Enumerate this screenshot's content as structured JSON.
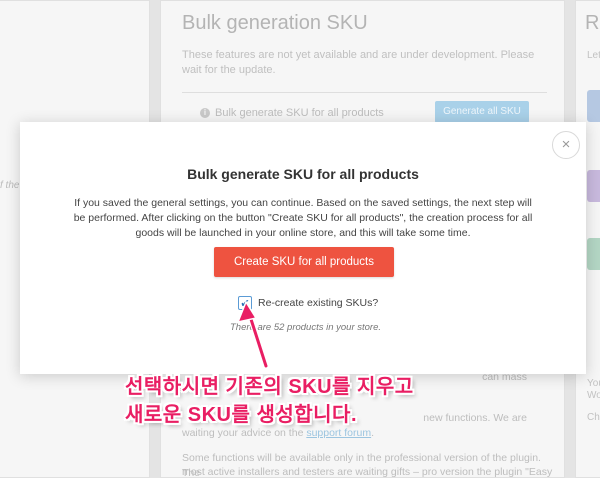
{
  "background": {
    "section_title": "Bulk generation SKU",
    "section_desc": "These features are not yet available and are under development. Please wait for the update.",
    "row_label": "Bulk generate SKU for all products",
    "row_button": "Generate all SKU",
    "para1_tail": "can mass",
    "para2_tail": "new functions. We are",
    "para2_line2_prefix": "waiting your advice on the",
    "support_link": "support forum",
    "para3_line1": "Some functions will be available only in the professional version of the plugin. The",
    "para3_line2": "most active installers and testers are waiting gifts – pro version the plugin \"Easy",
    "right_title_fragment": "Re",
    "right_small": [
      "Let",
      "You",
      "Wo",
      "Ch"
    ],
    "left_fragment": "f the",
    "info_icon": "info-icon"
  },
  "modal": {
    "close_label": "×",
    "title": "Bulk generate SKU for all products",
    "description": "If you saved the general settings, you can continue. Based on the saved settings, the next step will be performed. After clicking on the button \"Create SKU for all products\", the creation process for all goods will be launched in your online store, and this will take some time.",
    "create_button": "Create SKU for all products",
    "checkbox_checked": true,
    "checkbox_label": "Re-create existing SKUs?",
    "count_text": "There are 52 products in your store."
  },
  "callout": {
    "line1": "선택하시면 기존의 SKU를 지우고",
    "line2": "새로운 SKU를 생성합니다."
  },
  "colors": {
    "primary_button": "#ee5340",
    "annotation": "#e91e63",
    "checkbox_accent": "#2a6fb5"
  }
}
